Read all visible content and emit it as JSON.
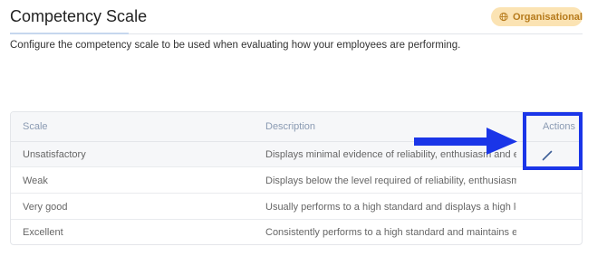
{
  "header": {
    "title": "Competency Scale",
    "badge_label": "Organisational",
    "badge_icon": "globe-icon",
    "badge_color": "#b67a1b"
  },
  "intro": "Configure the competency scale to be used when evaluating how your employees are performing.",
  "table": {
    "columns": [
      "Scale",
      "Description",
      "Actions"
    ],
    "rows": [
      {
        "scale": "Unsatisfactory",
        "description": "Displays minimal evidence of reliability, enthusiasm and en...",
        "action_icon": "pencil-icon"
      },
      {
        "scale": "Weak",
        "description": "Displays below the level required of reliability, enthusiasm ..."
      },
      {
        "scale": "Very good",
        "description": "Usually performs to a high standard and displays a high lev..."
      },
      {
        "scale": "Excellent",
        "description": "Consistently performs to a high standard and maintains ex..."
      }
    ]
  },
  "annotation": {
    "color": "#1a35e8",
    "shape": "arrow-pointing-to-actions-box"
  }
}
